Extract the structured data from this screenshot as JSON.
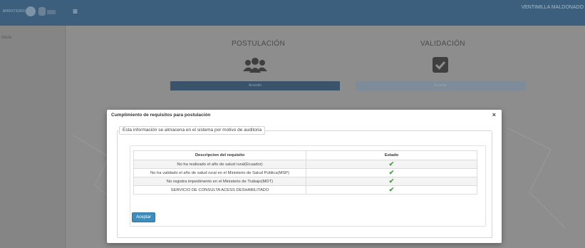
{
  "header": {
    "logo_text": "MINISTERIO",
    "menu_icon": "hamburger-icon",
    "user_name": "VENTIMILLA MALDONADO"
  },
  "sidebar": {
    "item_label": "Inicio"
  },
  "main": {
    "postulacion": {
      "title": "POSTULACIÓN",
      "icon": "users-icon",
      "button": "Acceder"
    },
    "validacion": {
      "title": "VALIDACIÓN",
      "icon": "checkbox-icon",
      "button": "Acceder"
    }
  },
  "modal": {
    "title": "Cumplimiento de requisitos para postulación",
    "close": "×",
    "legend": "Esta información se almacena en el sistema por motivo de auditoria",
    "table": {
      "headers": [
        "Descripcion del requisito",
        "Estado"
      ],
      "rows": [
        {
          "description": "No ha realizado el año de salud rural(Ecuador)",
          "status": "✔"
        },
        {
          "description": "No ha validado el año de salud rural en el Ministerio de Salud Pública(MSP)",
          "status": "✔"
        },
        {
          "description": "No registra impedimento en el Ministerio de Trabajo(MDT)",
          "status": "✔"
        },
        {
          "description": "SERVICIO DE CONSULTA ACESS DESHABILITADO",
          "status": "✔"
        }
      ]
    },
    "accept_button": "Aceptar"
  },
  "colors": {
    "topbar": "#3b5f7c",
    "accent": "#3c8dbc",
    "check": "#3fa535"
  }
}
